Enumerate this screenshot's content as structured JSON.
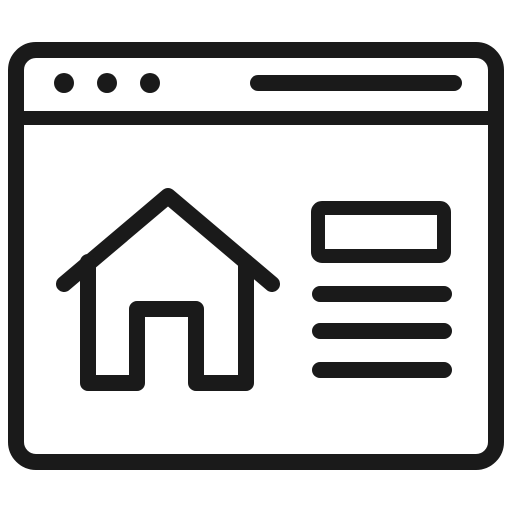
{
  "icon": {
    "name": "website-home-page-icon",
    "stroke_color": "#1a1a1a",
    "background_color": "#ffffff",
    "window_control_dots": 3,
    "content_text_lines": 3
  }
}
